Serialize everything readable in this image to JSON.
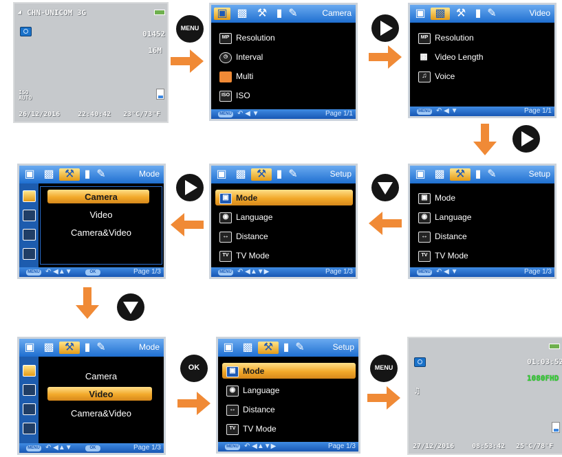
{
  "screen1": {
    "operator": "CHN-UNICOM 3G",
    "counter": "01452",
    "resolution": "16M",
    "iso": "ISO AUTO",
    "date": "26/12/2016",
    "time": "22:40:42",
    "temp": "23°C/73°F"
  },
  "buttons": {
    "menu_label": "MENU",
    "ok_label": "OK"
  },
  "screen2": {
    "title": "Camera",
    "items": [
      {
        "icon": "MP",
        "label": "Resolution"
      },
      {
        "icon": "",
        "label": "Interval"
      },
      {
        "icon": "",
        "label": "Multi"
      },
      {
        "icon": "ISO",
        "label": "ISO"
      }
    ],
    "page": "Page 1/1"
  },
  "screen3": {
    "title": "Video",
    "items": [
      {
        "icon": "MP",
        "label": "Resolution"
      },
      {
        "icon": "",
        "label": "Video Length"
      },
      {
        "icon": "",
        "label": "Voice"
      }
    ],
    "page": "Page 1/1"
  },
  "screen4": {
    "title": "Setup",
    "items": [
      {
        "label": "Mode"
      },
      {
        "label": "Language"
      },
      {
        "label": "Distance"
      },
      {
        "label": "TV Mode"
      }
    ],
    "page": "Page 1/3"
  },
  "screen5": {
    "title": "Setup",
    "items": [
      {
        "label": "Mode"
      },
      {
        "label": "Language"
      },
      {
        "label": "Distance"
      },
      {
        "label": "TV Mode"
      }
    ],
    "page": "Page 1/3"
  },
  "screen6": {
    "title": "Mode",
    "options": [
      "Camera",
      "Video",
      "Camera&Video"
    ],
    "ok": "OK",
    "page": "Page 1/3"
  },
  "screen7": {
    "title": "Mode",
    "options": [
      "Camera",
      "Video",
      "Camera&Video"
    ],
    "ok": "OK",
    "page": "Page 1/3"
  },
  "screen8": {
    "title": "Setup",
    "items": [
      {
        "label": "Mode"
      },
      {
        "label": "Language"
      },
      {
        "label": "Distance"
      },
      {
        "label": "TV Mode"
      }
    ],
    "page": "Page 1/3"
  },
  "screen9": {
    "time_remaining": "01:03:52",
    "video_res": "1080FHD",
    "date": "27/12/2016",
    "time": "08:53:42",
    "temp": "25°C/78°F"
  },
  "colors": {
    "highlight": "#f2a92a",
    "bar_blue": "#1f6fd0",
    "arrow_orange": "#f08a36"
  }
}
